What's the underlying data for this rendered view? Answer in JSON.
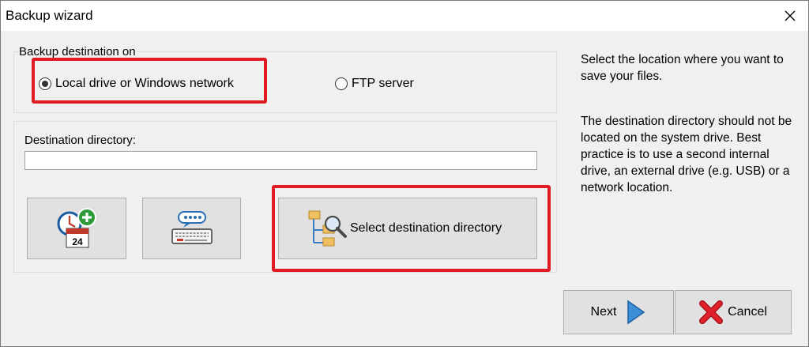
{
  "window": {
    "title": "Backup wizard"
  },
  "destination_group": {
    "legend": "Backup destination on",
    "options": [
      {
        "label": "Local drive or Windows network",
        "selected": true
      },
      {
        "label": "FTP server",
        "selected": false
      }
    ]
  },
  "directory": {
    "label": "Destination directory:",
    "value": "",
    "placeholder": ""
  },
  "buttons": {
    "select_destination": "Select destination directory",
    "next": "Next",
    "cancel": "Cancel"
  },
  "schedule_icon": {
    "day": "24"
  },
  "help": {
    "para1": "Select the location where you want to save your files.",
    "para2": "The destination directory should not be located on the system drive. Best practice is to use a second internal drive, an external drive (e.g. USB) or a network location."
  },
  "colors": {
    "highlight": "#e01b24",
    "button_face": "#e1e1e1",
    "next_arrow": "#3d8fd6",
    "cancel_x": "#e0202b"
  }
}
